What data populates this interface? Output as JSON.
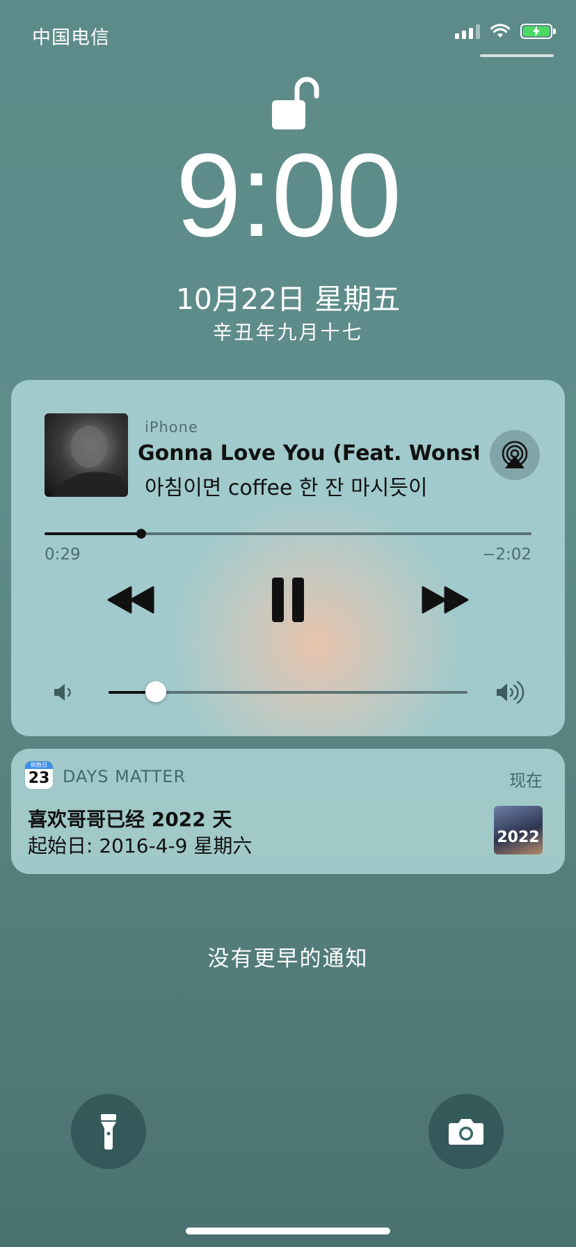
{
  "status_bar": {
    "carrier": "中国电信"
  },
  "lock_screen": {
    "time": "9:00",
    "date": "10月22日 星期五",
    "lunar_date": "辛丑年九月十七",
    "no_more_notifications": "没有更早的通知"
  },
  "now_playing": {
    "device": "iPhone",
    "song_title": "Gonna Love You (Feat. Wonste",
    "artist_line": "아침이면 coffee 한 잔 마시듯이",
    "elapsed": "0:29",
    "remaining": "−2:02",
    "progress_fraction": 0.19,
    "volume_fraction": 0.13
  },
  "notification": {
    "app_icon_header": "倒数日",
    "app_icon_day": "23",
    "app_name": "DAYS MATTER",
    "time": "现在",
    "title": "喜欢哥哥已经 2022 天",
    "body": "起始日: 2016-4-9 星期六",
    "thumbnail_text": "2022"
  },
  "colors": {
    "battery_fill": "#4cd964",
    "accent_blue": "#3a8ee6"
  }
}
